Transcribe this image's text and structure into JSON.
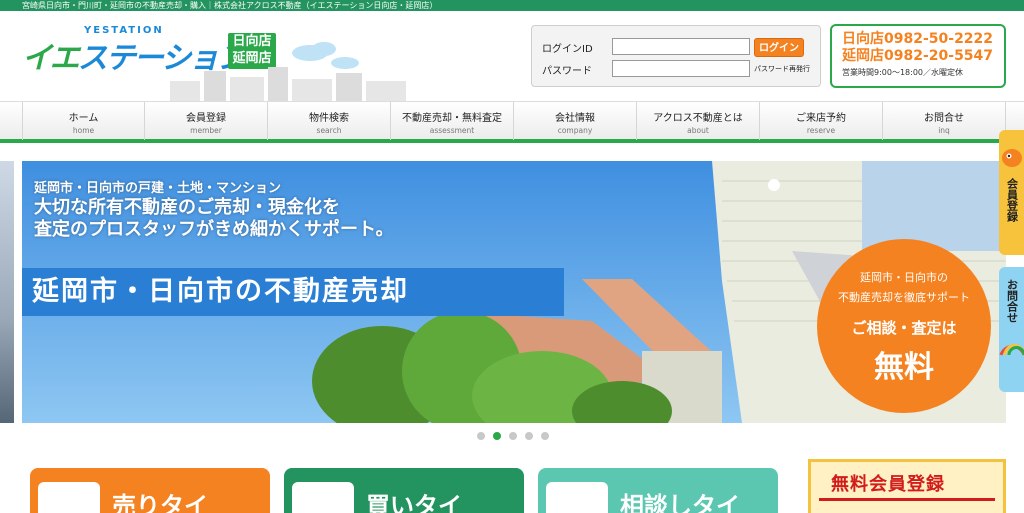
{
  "top_bar": {
    "text": "宮崎県日向市・門川町・延岡市の不動産売却・購入｜株式会社アクロス不動産（イエステーション日向店・延岡店）"
  },
  "logo": {
    "small": "YESTATION",
    "main_ie": "イエ",
    "main_station": "ステーション",
    "branch_line1": "日向店",
    "branch_line2": "延岡店"
  },
  "login": {
    "id_label": "ログインID",
    "password_label": "パスワード",
    "button_label": "ログイン",
    "reissue_label": "パスワード再発行",
    "id_value": "",
    "password_value": ""
  },
  "contact": {
    "hyuga_tel": "日向店0982-50-2222",
    "nobeoka_tel": "延岡店0982-20-5547",
    "hours": "営業時間9:00～18:00／水曜定休"
  },
  "nav": [
    {
      "jp": "ホーム",
      "en": "home"
    },
    {
      "jp": "会員登録",
      "en": "member"
    },
    {
      "jp": "物件検索",
      "en": "search"
    },
    {
      "jp": "不動産売却・無料査定",
      "en": "assessment"
    },
    {
      "jp": "会社情報",
      "en": "company"
    },
    {
      "jp": "アクロス不動産とは",
      "en": "about"
    },
    {
      "jp": "ご来店予約",
      "en": "reserve"
    },
    {
      "jp": "お問合せ",
      "en": "inq"
    }
  ],
  "hero": {
    "line1": "延岡市・日向市の戸建・土地・マンション",
    "line2": "大切な所有不動産のご売却・現金化を",
    "line3": "査定のプロスタッフがきめ細かくサポート。",
    "banner": "延岡市・日向市の不動産売却",
    "circle_line1": "延岡市・日向市の",
    "circle_line2": "不動産売却を徹底サポート",
    "circle_line3": "ご相談・査定は",
    "circle_line4": "無料"
  },
  "slider": {
    "count": 5,
    "active_index": 1
  },
  "side_tabs": [
    {
      "label": "会員登録",
      "color": "#f7c33c"
    },
    {
      "label": "お問合せ",
      "color": "#8fd3f2"
    }
  ],
  "features": [
    {
      "label": "売りタイ",
      "color": "#f58220"
    },
    {
      "label": "買いタイ",
      "color": "#23945f"
    },
    {
      "label": "相談しタイ",
      "color": "#5cc7b0"
    }
  ],
  "free_registration": {
    "label": "無料会員登録"
  },
  "colors": {
    "brand_green": "#2aa84a",
    "accent_orange": "#f58220",
    "hero_blue": "#2a7fd4"
  }
}
